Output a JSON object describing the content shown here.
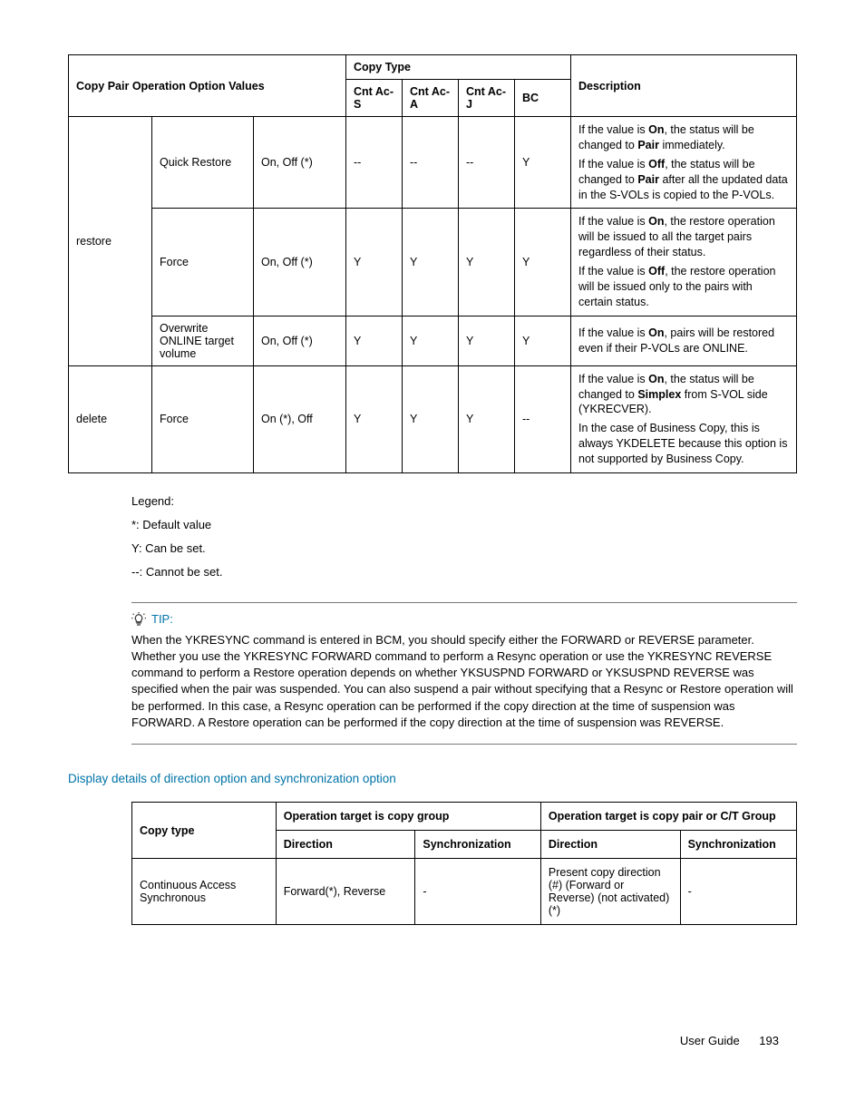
{
  "table1": {
    "headers": {
      "opValues": "Copy Pair Operation Option Values",
      "copyType": "Copy Type",
      "acs": "Cnt Ac-S",
      "aca": "Cnt Ac-A",
      "acj": "Cnt Ac-J",
      "bc": "BC",
      "desc": "Description"
    },
    "rows": [
      {
        "op": "restore",
        "sub": "Quick Restore",
        "vals": "On, Off (*)",
        "acs": "--",
        "aca": "--",
        "acj": "--",
        "bc": "Y",
        "desc1a": "If the value is ",
        "desc1b": "On",
        "desc1c": ", the status will be changed to ",
        "desc1d": "Pair",
        "desc1e": " immediately.",
        "desc2a": "If the value is ",
        "desc2b": "Off",
        "desc2c": ", the status will be changed to ",
        "desc2d": "Pair",
        "desc2e": " after all the updated data in the S-VOLs is copied to the P-VOLs."
      },
      {
        "sub": "Force",
        "vals": "On, Off (*)",
        "acs": "Y",
        "aca": "Y",
        "acj": "Y",
        "bc": "Y",
        "desc1a": "If the value is ",
        "desc1b": "On",
        "desc1c": ", the restore operation will be issued to all the target pairs regardless of their status.",
        "desc2a": "If the value is ",
        "desc2b": "Off",
        "desc2c": ", the restore operation will be issued only to the pairs with certain status."
      },
      {
        "sub": "Overwrite ONLINE target volume",
        "vals": "On, Off (*)",
        "acs": "Y",
        "aca": "Y",
        "acj": "Y",
        "bc": "Y",
        "desc1a": "If the value is ",
        "desc1b": "On",
        "desc1c": ", pairs will be restored even if their P-VOLs are ONLINE."
      },
      {
        "op": "delete",
        "sub": "Force",
        "vals": "On (*), Off",
        "acs": "Y",
        "aca": "Y",
        "acj": "Y",
        "bc": "--",
        "desc1a": "If the value is ",
        "desc1b": "On",
        "desc1c": ", the status will be changed to ",
        "desc1d": "Simplex",
        "desc1e": " from S-VOL side (YKRECVER).",
        "desc2a": "In the case of Business Copy, this is always YKDELETE because this option is not supported by Business Copy."
      }
    ]
  },
  "legend": {
    "title": "Legend:",
    "l1": "*: Default value",
    "l2": "Y: Can be set.",
    "l3": "--: Cannot be set."
  },
  "tip": {
    "label": "TIP:",
    "body": "When the YKRESYNC command is entered in BCM, you should specify either the FORWARD or REVERSE parameter. Whether you use the YKRESYNC FORWARD command to perform a Resync operation or use the YKRESYNC REVERSE command to perform a Restore operation depends on whether YKSUSPND FORWARD or YKSUSPND REVERSE was specified when the pair was suspended. You can also suspend a pair without specifying that a Resync or Restore operation will be performed. In this case, a Resync operation can be performed if the copy direction at the time of suspension was FORWARD. A Restore operation can be performed if the copy direction at the time of suspension was REVERSE."
  },
  "sectionTitle": "Display details of direction option and synchronization option",
  "table2": {
    "headers": {
      "copytype": "Copy type",
      "groupTarget": "Operation target is copy group",
      "pairTarget": "Operation target is copy pair or C/T Group",
      "dir": "Direction",
      "sync": "Synchronization"
    },
    "rows": [
      {
        "copytype": "Continuous Access Synchronous",
        "g_dir": "Forward(*), Reverse",
        "g_sync": "-",
        "p_dir": "Present copy direction (#) (Forward or Reverse) (not activated)(*)",
        "p_sync": "-"
      }
    ]
  },
  "footer": {
    "label": "User Guide",
    "page": "193"
  }
}
